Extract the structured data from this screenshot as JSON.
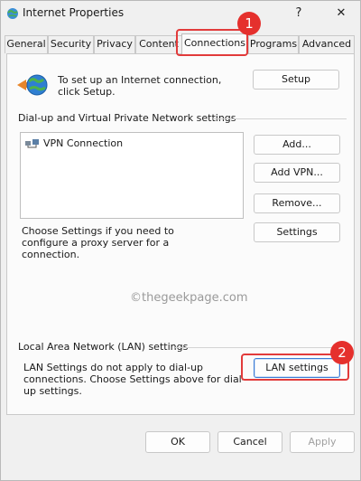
{
  "window": {
    "title": "Internet Properties",
    "help_glyph": "?",
    "close_glyph": "✕"
  },
  "tabs": [
    {
      "label": "General"
    },
    {
      "label": "Security"
    },
    {
      "label": "Privacy"
    },
    {
      "label": "Content"
    },
    {
      "label": "Connections",
      "active": true
    },
    {
      "label": "Programs"
    },
    {
      "label": "Advanced"
    }
  ],
  "callouts": {
    "tab_badge": "1",
    "lan_badge": "2",
    "color": "#e23b3b"
  },
  "setup": {
    "text": "To set up an Internet connection, click Setup.",
    "button": "Setup"
  },
  "dialup": {
    "group_title": "Dial-up and Virtual Private Network settings",
    "items": [
      "VPN Connection"
    ],
    "add_button": "Add...",
    "add_vpn_button": "Add VPN...",
    "remove_button": "Remove...",
    "proxy_text": "Choose Settings if you need to configure a proxy server for a connection.",
    "settings_button": "Settings"
  },
  "watermark": {
    "text": "©thegeekpage.com"
  },
  "lan": {
    "group_title": "Local Area Network (LAN) settings",
    "text": "LAN Settings do not apply to dial-up connections. Choose Settings above for dial-up settings.",
    "button": "LAN settings"
  },
  "footer": {
    "ok": "OK",
    "cancel": "Cancel",
    "apply": "Apply"
  },
  "icons": {
    "app": "internet-options-icon",
    "globe": "globe-connection-icon",
    "vpn": "vpn-network-icon"
  }
}
